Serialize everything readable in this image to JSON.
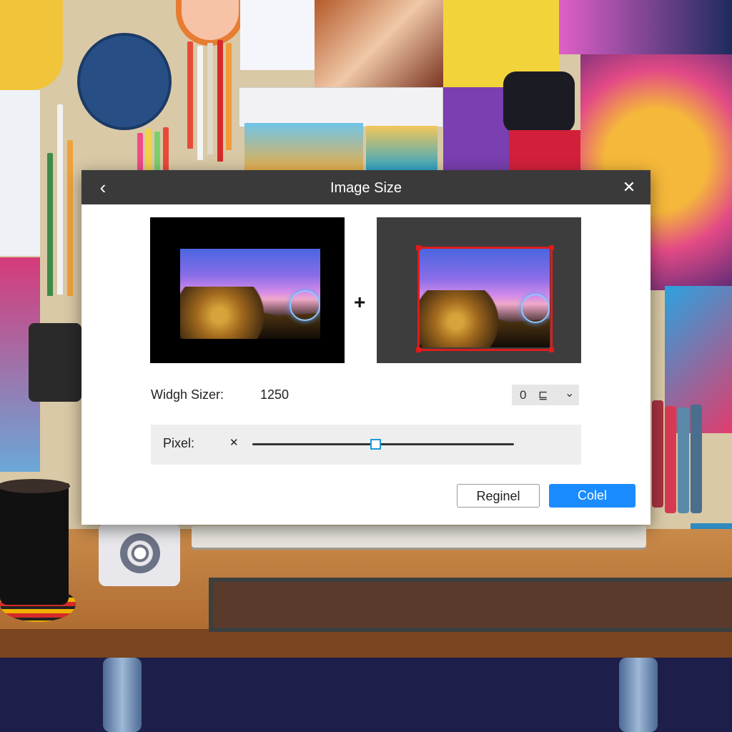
{
  "dialog": {
    "title": "Image Size",
    "back_icon": "‹",
    "close_icon": "✕",
    "plus_sign": "+"
  },
  "form": {
    "width_label": "Widgh Sizer:",
    "width_value": "1250",
    "unit_select": {
      "value": "0",
      "glyph": "⊑",
      "chevron": "⌄"
    },
    "pixel_label": "Pixel:",
    "pixel_clear_icon": "✕",
    "slider_fraction": 0.47
  },
  "buttons": {
    "secondary_label": "Reginel",
    "primary_label": "Colel"
  },
  "colors": {
    "titlebar": "#3a3a3a",
    "primary": "#1a8cff",
    "crop_frame": "#e01b1b",
    "slider_accent": "#1a9bd7"
  }
}
